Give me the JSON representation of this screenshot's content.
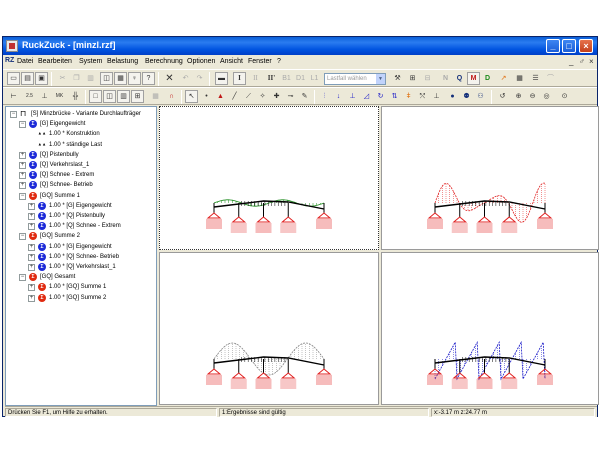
{
  "window": {
    "title": "RuckZuck - [minzl.rzf]",
    "buttons": [
      "_",
      "□",
      "×"
    ]
  },
  "menubar": {
    "logo": "RZ",
    "items": [
      "Datei",
      "Bearbeiten",
      "System",
      "Belastung",
      "Berechnung",
      "Optionen",
      "Ansicht",
      "Fenster",
      "?"
    ],
    "mdi_buttons": [
      "_",
      "♂",
      "×"
    ]
  },
  "toolbar1": {
    "buttons": [
      "new-file",
      "open-file",
      "save-file",
      "cut",
      "copy",
      "paste",
      "print-preview",
      "print",
      "properties",
      "help",
      "delete",
      "undo",
      "redo",
      "monitor",
      "I",
      "II",
      "II'",
      "B1",
      "D1",
      "L1"
    ],
    "load_case_placeholder": "Lastfall wählen",
    "right_labels": [
      "N",
      "Q",
      "M",
      "D"
    ]
  },
  "toolbar2": {
    "buttons": [
      "node",
      "dim-25",
      "dim-axis",
      "mark-mk",
      "grid",
      "view-1",
      "view-2",
      "view-3",
      "view-4",
      "view-grid",
      "magnet",
      "pointer",
      "point",
      "support",
      "line",
      "line-2",
      "node-add",
      "cross",
      "hinge",
      "pen",
      "dist-load",
      "point-load",
      "load-3",
      "load-4",
      "load-5",
      "load-6",
      "load-7",
      "load-8",
      "person",
      "persons",
      "persons-2",
      "undo-view",
      "zoom-in",
      "zoom-out",
      "zoom-all",
      "zoom-fit"
    ]
  },
  "tree": {
    "rows": [
      {
        "label": "[S] Minzbrücke - Variante Durchlaufträger",
        "kind": "root"
      },
      {
        "label": "[G] Eigengewicht",
        "kind": "blue"
      },
      {
        "label": "1.00 * Konstruktion",
        "kind": "leaf"
      },
      {
        "label": "1.00 * ständige Last",
        "kind": "leaf"
      },
      {
        "label": "[Q] Pistenbully",
        "kind": "blue"
      },
      {
        "label": "[Q] Verkehrslast_1",
        "kind": "blue"
      },
      {
        "label": "[Q] Schnee - Extrem",
        "kind": "blue"
      },
      {
        "label": "[Q] Schnee- Betrieb",
        "kind": "blue"
      },
      {
        "label": "[GQ] Summe 1",
        "kind": "red"
      },
      {
        "label": "1.00 * [G] Eigengewicht",
        "kind": "blue"
      },
      {
        "label": "1.00 * [Q] Pistenbully",
        "kind": "blue"
      },
      {
        "label": "1.00 * [Q] Schnee - Extrem",
        "kind": "blue"
      },
      {
        "label": "[GQ] Summe 2",
        "kind": "red"
      },
      {
        "label": "1.00 * [G] Eigengewicht",
        "kind": "blue"
      },
      {
        "label": "1.00 * [Q] Schnee- Betrieb",
        "kind": "blue"
      },
      {
        "label": "1.00 * [Q] Verkehrslast_1",
        "kind": "blue"
      },
      {
        "label": "[GQ] Gesamt",
        "kind": "red"
      },
      {
        "label": "1.00 * [GQ] Summe 1",
        "kind": "red"
      },
      {
        "label": "1.00 * [GQ] Summe 2",
        "kind": "red"
      }
    ]
  },
  "views": {
    "colors": {
      "green": "#1a8a1a",
      "red": "#e02020",
      "gray": "#888888",
      "blue": "#1818c8",
      "black": "#000000"
    }
  },
  "status": {
    "help": "Drücken Sie F1, um Hilfe zu erhalten.",
    "result": "1:Ergebnisse sind gültig",
    "coords": "x:-3.17 m z:24.77 m"
  }
}
